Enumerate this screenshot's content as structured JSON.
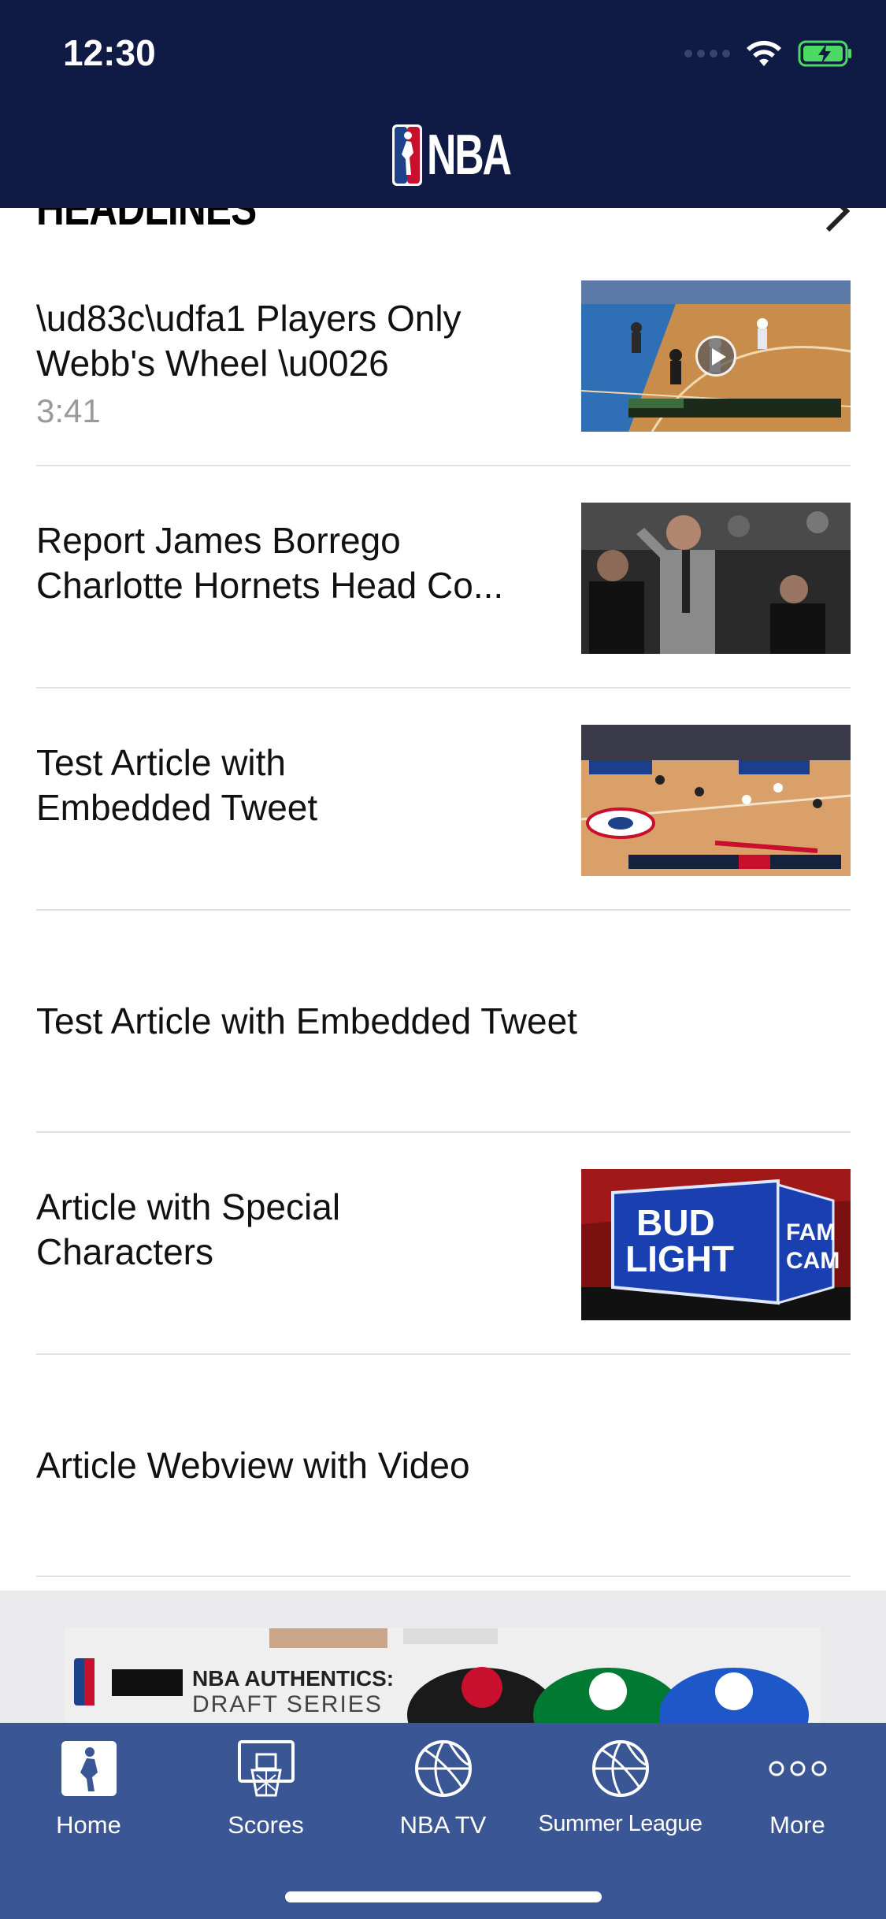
{
  "status_bar": {
    "time": "12:30"
  },
  "header": {
    "logo_text": "NBA"
  },
  "section": {
    "title": "HEADLINES"
  },
  "articles": [
    {
      "title": "\\ud83c\\udfa1 Players Only Webb's Wheel \\u0026",
      "duration": "3:41",
      "has_thumbnail": true,
      "has_video": true
    },
    {
      "title": "Report James Borrego Charlotte Hornets Head Co...",
      "has_thumbnail": true
    },
    {
      "title": "Test Article with Embedded Tweet",
      "has_thumbnail": true
    },
    {
      "title": "Test Article with Embedded Tweet",
      "has_thumbnail": false
    },
    {
      "title": "Article with Special Characters",
      "has_thumbnail": true
    },
    {
      "title": "Article Webview with Video",
      "has_thumbnail": false
    }
  ],
  "thumbnails": {
    "budlight_line1": "BUD",
    "budlight_line2": "LIGHT",
    "budlight_fam": "FAM",
    "budlight_cam": "CAM"
  },
  "ad": {
    "headline": "NBA AUTHENTICS:",
    "subline": "DRAFT SERIES"
  },
  "tabbar": {
    "tabs": [
      {
        "label": "Home",
        "icon": "nba-logo-icon",
        "active": true
      },
      {
        "label": "Scores",
        "icon": "basketball-hoop-icon"
      },
      {
        "label": "NBA TV",
        "icon": "basketball-icon"
      },
      {
        "label": "Summer League",
        "icon": "basketball-icon"
      },
      {
        "label": "More",
        "icon": "more-dots-icon"
      }
    ]
  },
  "colors": {
    "header_bg": "#0f1a45",
    "tabbar_bg": "#3a5694",
    "divider": "#e1e1e1",
    "duration_text": "#9a9a9a"
  }
}
